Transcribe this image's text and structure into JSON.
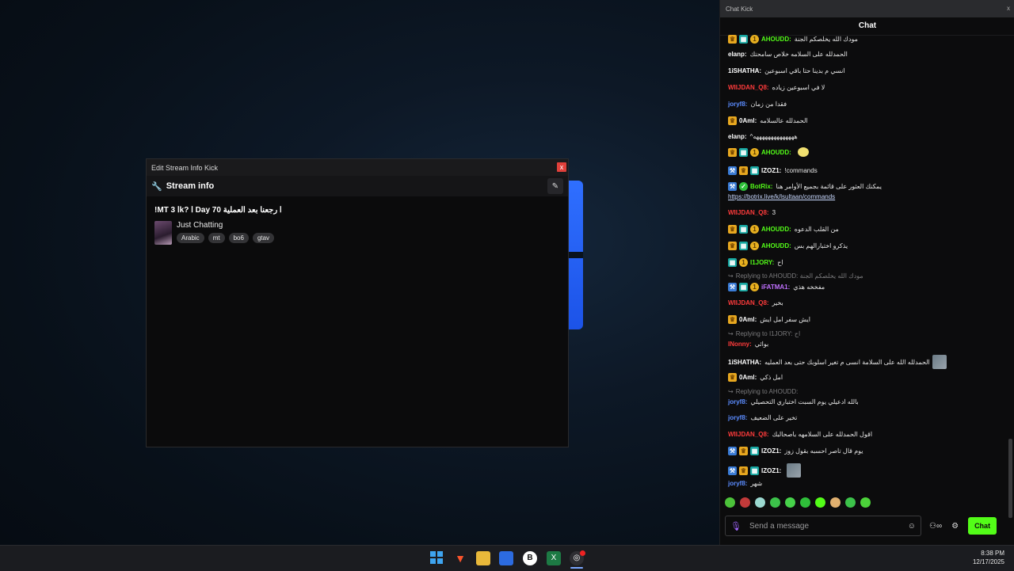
{
  "stream_window": {
    "title": "Edit Stream Info Kick",
    "close": "x",
    "header": "Stream info",
    "stream_title": "!MT ا 3k? ا Day 70 ا رجعنا بعد العملية",
    "category": "Just Chatting",
    "tags": [
      "Arabic",
      "mt",
      "bo6",
      "gtav"
    ]
  },
  "chat_window": {
    "title": "Chat Kick",
    "close": "x",
    "header": "Chat",
    "messages": [
      {
        "user": "AHOUDD:",
        "color": "#53fc18",
        "text": "مودك الله يخلصكم الجنة",
        "badges": [
          "crown",
          "sub",
          "coin"
        ]
      },
      {
        "user": "elanp:",
        "color": "#ffffff",
        "text": "الحمدلله على السلامه خلاص سامحتك",
        "badges": []
      },
      {
        "user": "1iSHATHA:",
        "color": "#ffffff",
        "text": "انسي م بدينا حتا باقي اسبوعين",
        "badges": []
      },
      {
        "user": "WIIJDAN_Q8:",
        "color": "#ff3b3b",
        "text": "لا في اسبوعين زياده",
        "badges": []
      },
      {
        "user": "joryf8:",
        "color": "#5b8cff",
        "text": "فقدا من زمان",
        "badges": []
      },
      {
        "user": "0Aml:",
        "color": "#ffffff",
        "text": "الحمدلله عالسلامه",
        "badges": [
          "crown"
        ]
      },
      {
        "user": "elanp:",
        "color": "#ffffff",
        "text": "^ههههههههههههههه",
        "badges": []
      },
      {
        "user": "AHOUDD:",
        "color": "#53fc18",
        "text": "",
        "badges": [
          "crown",
          "sub",
          "coin"
        ],
        "emote": true
      },
      {
        "user": "IZOZ1:",
        "color": "#ffffff",
        "text": "!commands",
        "badges": [
          "tool",
          "crown",
          "sub"
        ]
      },
      {
        "user": "BotRix:",
        "color": "#53fc18",
        "text": "يمكنك العثور على قائمة بجميع الأوامر هنا",
        "badges": [
          "tool",
          "check"
        ]
      },
      {
        "link": "https://botrix.live/k/lsultaan/commands"
      },
      {
        "user": "WIIJDAN_Q8:",
        "color": "#ff3b3b",
        "text": "3",
        "badges": []
      },
      {
        "user": "AHOUDD:",
        "color": "#53fc18",
        "text": "من القلب الدعوه",
        "badges": [
          "crown",
          "sub",
          "coin"
        ]
      },
      {
        "user": "AHOUDD:",
        "color": "#53fc18",
        "text": "يذكرو اختبارالهم بس",
        "badges": [
          "crown",
          "sub",
          "coin"
        ]
      },
      {
        "user": "I1JORY:",
        "color": "#53fc18",
        "text": "اح",
        "badges": [
          "sub",
          "coin"
        ]
      },
      {
        "reply": "Replying to AHOUDD: مودك الله يخلصكم الجنة"
      },
      {
        "user": "iFATMA1:",
        "color": "#c070ff",
        "text": "مفخخه هذي",
        "badges": [
          "tool",
          "sub",
          "coin"
        ]
      },
      {
        "user": "WIIJDAN_Q8:",
        "color": "#ff3b3b",
        "text": "بخير",
        "badges": []
      },
      {
        "user": "0Aml:",
        "color": "#ffffff",
        "text": "ايش سفر امل ايش",
        "badges": [
          "crown"
        ]
      },
      {
        "reply": "Replying to I1JORY: اح"
      },
      {
        "user": "INonny:",
        "color": "#ff3b3b",
        "text": "بوائي",
        "badges": []
      },
      {
        "user": "1iSHATHA:",
        "color": "#ffffff",
        "text": "الحمدلله الله على السلامة انسى م تغير اسلوبك حتى بعد العمليه",
        "badges": [],
        "img": true
      },
      {
        "user": "0Aml:",
        "color": "#ffffff",
        "text": "امل ذكي",
        "badges": [
          "crown"
        ]
      },
      {
        "reply": "Replying to AHOUDD:"
      },
      {
        "user": "joryf8:",
        "color": "#5b8cff",
        "text": "بالله ادعيلي يوم السبت اختباري التحصيلي",
        "badges": []
      },
      {
        "user": "joryf8:",
        "color": "#5b8cff",
        "text": "تخير على الضعيف",
        "badges": []
      },
      {
        "user": "WIIJDAN_Q8:",
        "color": "#ff3b3b",
        "text": "اقول الحمدلله على السلامهه باصحالبك",
        "badges": []
      },
      {
        "user": "IZOZ1:",
        "color": "#ffffff",
        "text": "يوم قال تاصر احسبه بقول زوز",
        "badges": [
          "tool",
          "crown",
          "sub"
        ]
      },
      {
        "user": "IZOZ1:",
        "color": "#ffffff",
        "text": "",
        "badges": [
          "tool",
          "crown",
          "sub"
        ],
        "img": true
      },
      {
        "user": "joryf8:",
        "color": "#5b8cff",
        "text": "شهر",
        "badges": []
      }
    ],
    "input_placeholder": "Send a message",
    "send_label": "Chat"
  },
  "taskbar": {
    "time": "8:38 PM",
    "date": "12/17/2025"
  }
}
